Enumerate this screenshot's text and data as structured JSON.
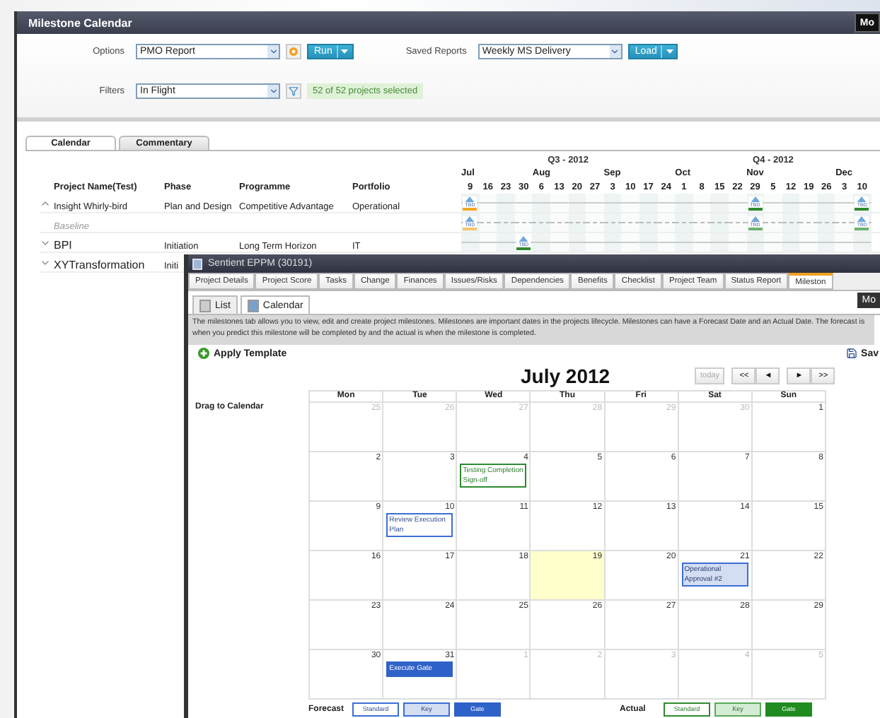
{
  "app": {
    "title": "Milestone Calendar",
    "header_button": "Mo"
  },
  "options": {
    "label": "Options",
    "value": "PMO Report",
    "run": "Run"
  },
  "saved_reports": {
    "label": "Saved Reports",
    "value": "Weekly MS Delivery",
    "load": "Load"
  },
  "filters": {
    "label": "Filters",
    "value": "In Flight",
    "count": "52 of 52 projects selected"
  },
  "tabs": [
    {
      "label": "Calendar",
      "selected": true
    },
    {
      "label": "Commentary",
      "selected": false
    }
  ],
  "timeline": {
    "quarters": [
      {
        "label": "Q3 - 2012",
        "months": [
          {
            "label": "Jul",
            "weeks": [
              "9",
              "16",
              "23",
              "30"
            ]
          },
          {
            "label": "Aug",
            "weeks": [
              "6",
              "13",
              "20",
              "27"
            ]
          },
          {
            "label": "Sep",
            "weeks": [
              "3",
              "10",
              "17",
              "24"
            ]
          }
        ]
      },
      {
        "label": "Q4 - 2012",
        "months": [
          {
            "label": "Oct",
            "weeks": [
              "1",
              "8",
              "15",
              "22"
            ]
          },
          {
            "label": "Nov",
            "weeks": [
              "29",
              "5",
              "12",
              "19",
              "26"
            ]
          },
          {
            "label": "Dec",
            "weeks": [
              "3",
              "10"
            ]
          }
        ]
      }
    ]
  },
  "table": {
    "columns": [
      "Project Name(Test)",
      "Phase",
      "Programme",
      "Portfolio"
    ],
    "rows": [
      {
        "kind": "project",
        "expanded": true,
        "name": "Insight Whirly-bird",
        "phase": "Plan and Design",
        "programme": "Competitive Advantage",
        "portfolio": "Operational",
        "weeks": [
          {
            "milestone": true,
            "label": "TBD",
            "color": "#f5a623"
          },
          {
            "milestone": false
          },
          {
            "milestone": false
          },
          {
            "milestone": false
          },
          {
            "milestone": false
          },
          {
            "milestone": false
          },
          {
            "milestone": false
          },
          {
            "milestone": false
          },
          {
            "milestone": false
          },
          {
            "milestone": false
          },
          {
            "milestone": false
          },
          {
            "milestone": false
          },
          {
            "milestone": false
          },
          {
            "milestone": false
          },
          {
            "milestone": false
          },
          {
            "milestone": false
          },
          {
            "milestone": true,
            "label": "TBD",
            "color": "#2e8b2e"
          },
          {
            "milestone": false
          },
          {
            "milestone": false
          },
          {
            "milestone": false
          },
          {
            "milestone": false
          },
          {
            "milestone": false
          },
          {
            "milestone": true,
            "label": "TBD",
            "color": "#2e8b2e"
          }
        ]
      },
      {
        "kind": "baseline",
        "name": "Baseline",
        "weeks": [
          {
            "milestone": true,
            "label": "TBD",
            "color": "#f7c46c"
          },
          {
            "milestone": false
          },
          {
            "milestone": false
          },
          {
            "milestone": false
          },
          {
            "milestone": false
          },
          {
            "milestone": false
          },
          {
            "milestone": false
          },
          {
            "milestone": false
          },
          {
            "milestone": false
          },
          {
            "milestone": false
          },
          {
            "milestone": false
          },
          {
            "milestone": false
          },
          {
            "milestone": false
          },
          {
            "milestone": false
          },
          {
            "milestone": false
          },
          {
            "milestone": false
          },
          {
            "milestone": true,
            "label": "TBD",
            "color": "#6cb36c"
          },
          {
            "milestone": false
          },
          {
            "milestone": false
          },
          {
            "milestone": false
          },
          {
            "milestone": false
          },
          {
            "milestone": false
          },
          {
            "milestone": true,
            "label": "TBD",
            "color": "#6cb36c"
          }
        ]
      },
      {
        "kind": "project",
        "expanded": false,
        "name": "BPI",
        "phase": "Initiation",
        "programme": "Long Term Horizon",
        "portfolio": "IT",
        "weeks": [
          {
            "milestone": false
          },
          {
            "milestone": false
          },
          {
            "milestone": false
          },
          {
            "milestone": true,
            "label": "TBD",
            "color": "#2e8b2e"
          },
          {
            "milestone": false
          },
          {
            "milestone": false
          },
          {
            "milestone": false
          },
          {
            "milestone": false
          },
          {
            "milestone": false
          },
          {
            "milestone": false
          },
          {
            "milestone": false
          },
          {
            "milestone": false
          },
          {
            "milestone": false
          },
          {
            "milestone": false
          },
          {
            "milestone": false
          },
          {
            "milestone": false
          },
          {
            "milestone": false
          },
          {
            "milestone": false
          },
          {
            "milestone": false
          },
          {
            "milestone": false
          },
          {
            "milestone": false
          },
          {
            "milestone": false
          },
          {
            "milestone": false
          }
        ]
      },
      {
        "kind": "project",
        "expanded": false,
        "name": "XYTransformation",
        "phase": "Initi"
      }
    ]
  },
  "dialog": {
    "title": "Sentient EPPM (30191)",
    "tabs": [
      {
        "label": "Project Details",
        "selected": false
      },
      {
        "label": "Project Score",
        "selected": false
      },
      {
        "label": "Tasks",
        "selected": false
      },
      {
        "label": "Change",
        "selected": false
      },
      {
        "label": "Finances",
        "selected": false
      },
      {
        "label": "Issues/Risks",
        "selected": false
      },
      {
        "label": "Dependencies",
        "selected": false
      },
      {
        "label": "Benefits",
        "selected": false
      },
      {
        "label": "Checklist",
        "selected": false
      },
      {
        "label": "Project Team",
        "selected": false
      },
      {
        "label": "Status Report",
        "selected": false
      },
      {
        "label": "Mileston",
        "selected": true
      }
    ],
    "views": [
      {
        "label": "List",
        "selected": false
      },
      {
        "label": "Calendar",
        "selected": true
      }
    ],
    "menu_button": "Mo",
    "description": "The milestones tab allows you to view, edit and create project milestones. Milestones are important dates in the projects lifecycle. Milestones can have a Forecast Date and an Actual Date. The forecast is when you predict this milestone will be completed by and the actual is when the milestone is completed.",
    "apply_template": "Apply Template",
    "save": "Sav",
    "drag_label": "Drag to Calendar",
    "calendar": {
      "title": "July 2012",
      "nav": [
        {
          "label": "today",
          "disabled": true
        },
        {
          "label": "<<",
          "disabled": false
        },
        {
          "label": "◄",
          "disabled": false
        },
        {
          "label": "►",
          "disabled": false
        },
        {
          "label": ">>",
          "disabled": false
        }
      ],
      "weekdays": [
        "Mon",
        "Tue",
        "Wed",
        "Thu",
        "Fri",
        "Sat",
        "Sun"
      ],
      "weeks": [
        [
          {
            "day": "25",
            "muted": true,
            "today": false
          },
          {
            "day": "26",
            "muted": true,
            "today": false
          },
          {
            "day": "27",
            "muted": true,
            "today": false
          },
          {
            "day": "28",
            "muted": true,
            "today": false
          },
          {
            "day": "29",
            "muted": true,
            "today": false
          },
          {
            "day": "30",
            "muted": true,
            "today": false
          },
          {
            "day": "1",
            "muted": false,
            "today": false
          }
        ],
        [
          {
            "day": "2",
            "muted": false,
            "today": false
          },
          {
            "day": "3",
            "muted": false,
            "today": false
          },
          {
            "day": "4",
            "muted": false,
            "today": false,
            "events": [
              {
                "title": "Testing Completion Sign-off",
                "actual": true,
                "kind": "standard"
              }
            ]
          },
          {
            "day": "5",
            "muted": false,
            "today": false
          },
          {
            "day": "6",
            "muted": false,
            "today": false
          },
          {
            "day": "7",
            "muted": false,
            "today": false
          },
          {
            "day": "8",
            "muted": false,
            "today": false
          }
        ],
        [
          {
            "day": "9",
            "muted": false,
            "today": false
          },
          {
            "day": "10",
            "muted": false,
            "today": false,
            "events": [
              {
                "title": "Review Execution Plan",
                "actual": false,
                "kind": "standard"
              }
            ]
          },
          {
            "day": "11",
            "muted": false,
            "today": false
          },
          {
            "day": "12",
            "muted": false,
            "today": false
          },
          {
            "day": "13",
            "muted": false,
            "today": false
          },
          {
            "day": "14",
            "muted": false,
            "today": false
          },
          {
            "day": "15",
            "muted": false,
            "today": false
          }
        ],
        [
          {
            "day": "16",
            "muted": false,
            "today": false
          },
          {
            "day": "17",
            "muted": false,
            "today": false
          },
          {
            "day": "18",
            "muted": false,
            "today": false
          },
          {
            "day": "19",
            "muted": false,
            "today": true
          },
          {
            "day": "20",
            "muted": false,
            "today": false
          },
          {
            "day": "21",
            "muted": false,
            "today": false,
            "events": [
              {
                "title": "Operational Approval #2",
                "actual": false,
                "kind": "key"
              }
            ]
          },
          {
            "day": "22",
            "muted": false,
            "today": false
          }
        ],
        [
          {
            "day": "23",
            "muted": false,
            "today": false
          },
          {
            "day": "24",
            "muted": false,
            "today": false
          },
          {
            "day": "25",
            "muted": false,
            "today": false
          },
          {
            "day": "26",
            "muted": false,
            "today": false
          },
          {
            "day": "27",
            "muted": false,
            "today": false
          },
          {
            "day": "28",
            "muted": false,
            "today": false
          },
          {
            "day": "29",
            "muted": false,
            "today": false
          }
        ],
        [
          {
            "day": "30",
            "muted": false,
            "today": false
          },
          {
            "day": "31",
            "muted": false,
            "today": false,
            "events": [
              {
                "title": "Execute Gate",
                "actual": false,
                "kind": "gate"
              }
            ]
          },
          {
            "day": "1",
            "muted": true,
            "today": false
          },
          {
            "day": "2",
            "muted": true,
            "today": false
          },
          {
            "day": "3",
            "muted": true,
            "today": false
          },
          {
            "day": "4",
            "muted": true,
            "today": false
          },
          {
            "day": "5",
            "muted": true,
            "today": false
          }
        ]
      ],
      "legend": [
        {
          "label": "Forecast",
          "actual": false,
          "items": [
            {
              "label": "Standard",
              "kind": "standard"
            },
            {
              "label": "Key",
              "kind": "key"
            },
            {
              "label": "Gate",
              "kind": "gate"
            }
          ]
        },
        {
          "label": "Actual",
          "actual": true,
          "items": [
            {
              "label": "Standard",
              "kind": "standard"
            },
            {
              "label": "Key",
              "kind": "key"
            },
            {
              "label": "Gate",
              "kind": "gate"
            }
          ]
        }
      ]
    }
  }
}
